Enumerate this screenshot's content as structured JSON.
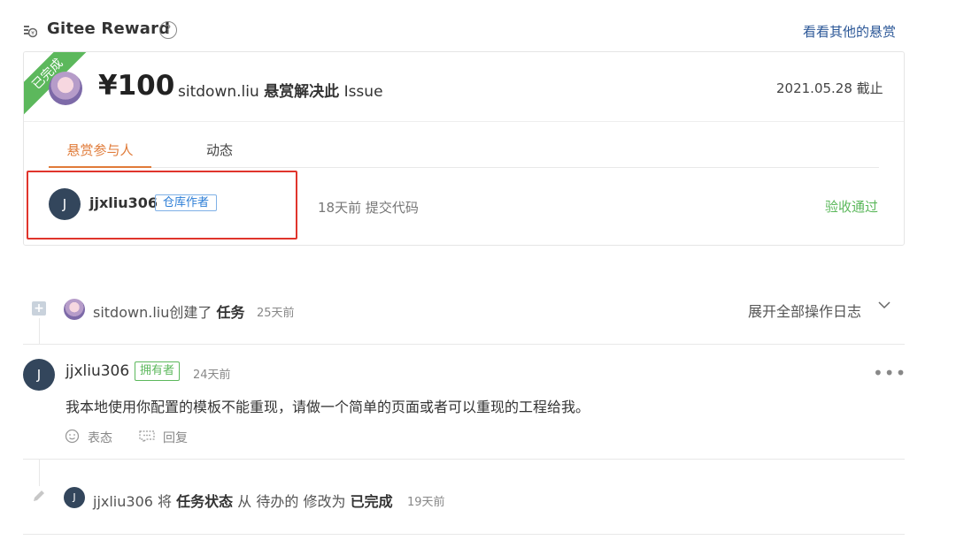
{
  "header": {
    "title": "Gitee Reward",
    "help_icon": "?",
    "other_rewards_link": "看看其他的悬赏"
  },
  "reward": {
    "ribbon": "已完成",
    "amount": "¥100",
    "issuer": "sitdown.liu",
    "issuer_action": "悬赏解决此",
    "issuer_target": "Issue",
    "deadline": "2021.05.28 截止"
  },
  "tabs": {
    "participants": "悬赏参与人",
    "activity": "动态"
  },
  "participant": {
    "avatar_letter": "J",
    "name": "jjxliu306",
    "badge": "仓库作者",
    "action": "18天前 提交代码",
    "status": "验收通过"
  },
  "timeline": {
    "event1": {
      "user": "sitdown.liu",
      "verb": "创建了",
      "object": "任务",
      "time": "25天前"
    },
    "expand_label": "展开全部操作日志",
    "comment": {
      "avatar_letter": "J",
      "user": "jjxliu306",
      "badge": "拥有者",
      "time": "24天前",
      "more": "•••",
      "body": "我本地使用你配置的模板不能重现，请做一个简单的页面或者可以重现的工程给我。",
      "react_label": "表态",
      "reply_label": "回复"
    },
    "event2": {
      "avatar_letter": "J",
      "user": "jjxliu306",
      "verb": "将",
      "field": "任务状态",
      "from_word": "从",
      "from_value": "待办的",
      "to_word": "修改为",
      "to_value": "已完成",
      "time": "19天前"
    }
  },
  "colors": {
    "accent_orange": "#e07b39",
    "success_green": "#5cb85c",
    "link_blue": "#2b5797",
    "highlight_red": "#e0352c"
  }
}
